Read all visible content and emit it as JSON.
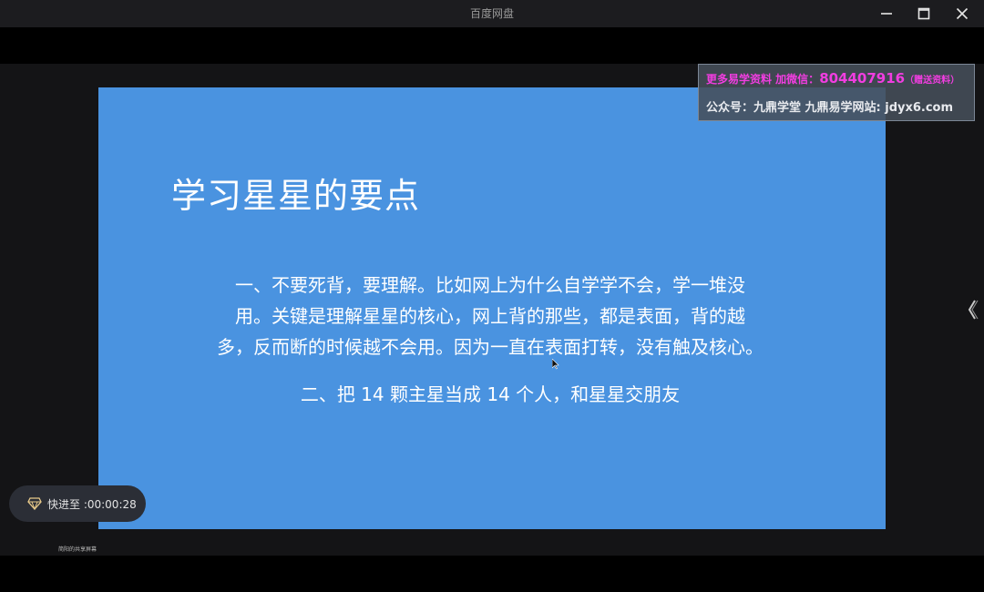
{
  "window": {
    "title": "百度网盘"
  },
  "slide": {
    "title": "学习星星的要点",
    "point1_line1": "一、不要死背，要理解。比如网上为什么自学学不会，学一堆没",
    "point1_line2": "用。关键是理解星星的核心，网上背的那些，都是表面，背的越",
    "point1_line3": "多，反而断的时候越不会用。因为一直在表面打转，没有触及核心。",
    "point2": "二、把 14 颗主星当成 14 个人，和星星交朋友",
    "background_color": "#4a93e0"
  },
  "watermark": {
    "line1_prefix": "更多易学资料 加微信：",
    "line1_number": "804407916",
    "line1_suffix": "（赠送资料）",
    "line2": "公众号：九鼎学堂 九鼎易学网站: jdyx6.com"
  },
  "player": {
    "fast_forward_label": "快进至 :00:00:28",
    "bottom_caption": "简阳的共享屏幕"
  },
  "icons": {
    "minimize": "minimize-icon",
    "maximize": "maximize-icon",
    "close": "close-icon",
    "side_arrow": "chevron-left-icon",
    "fast_forward": "diamond-icon"
  }
}
